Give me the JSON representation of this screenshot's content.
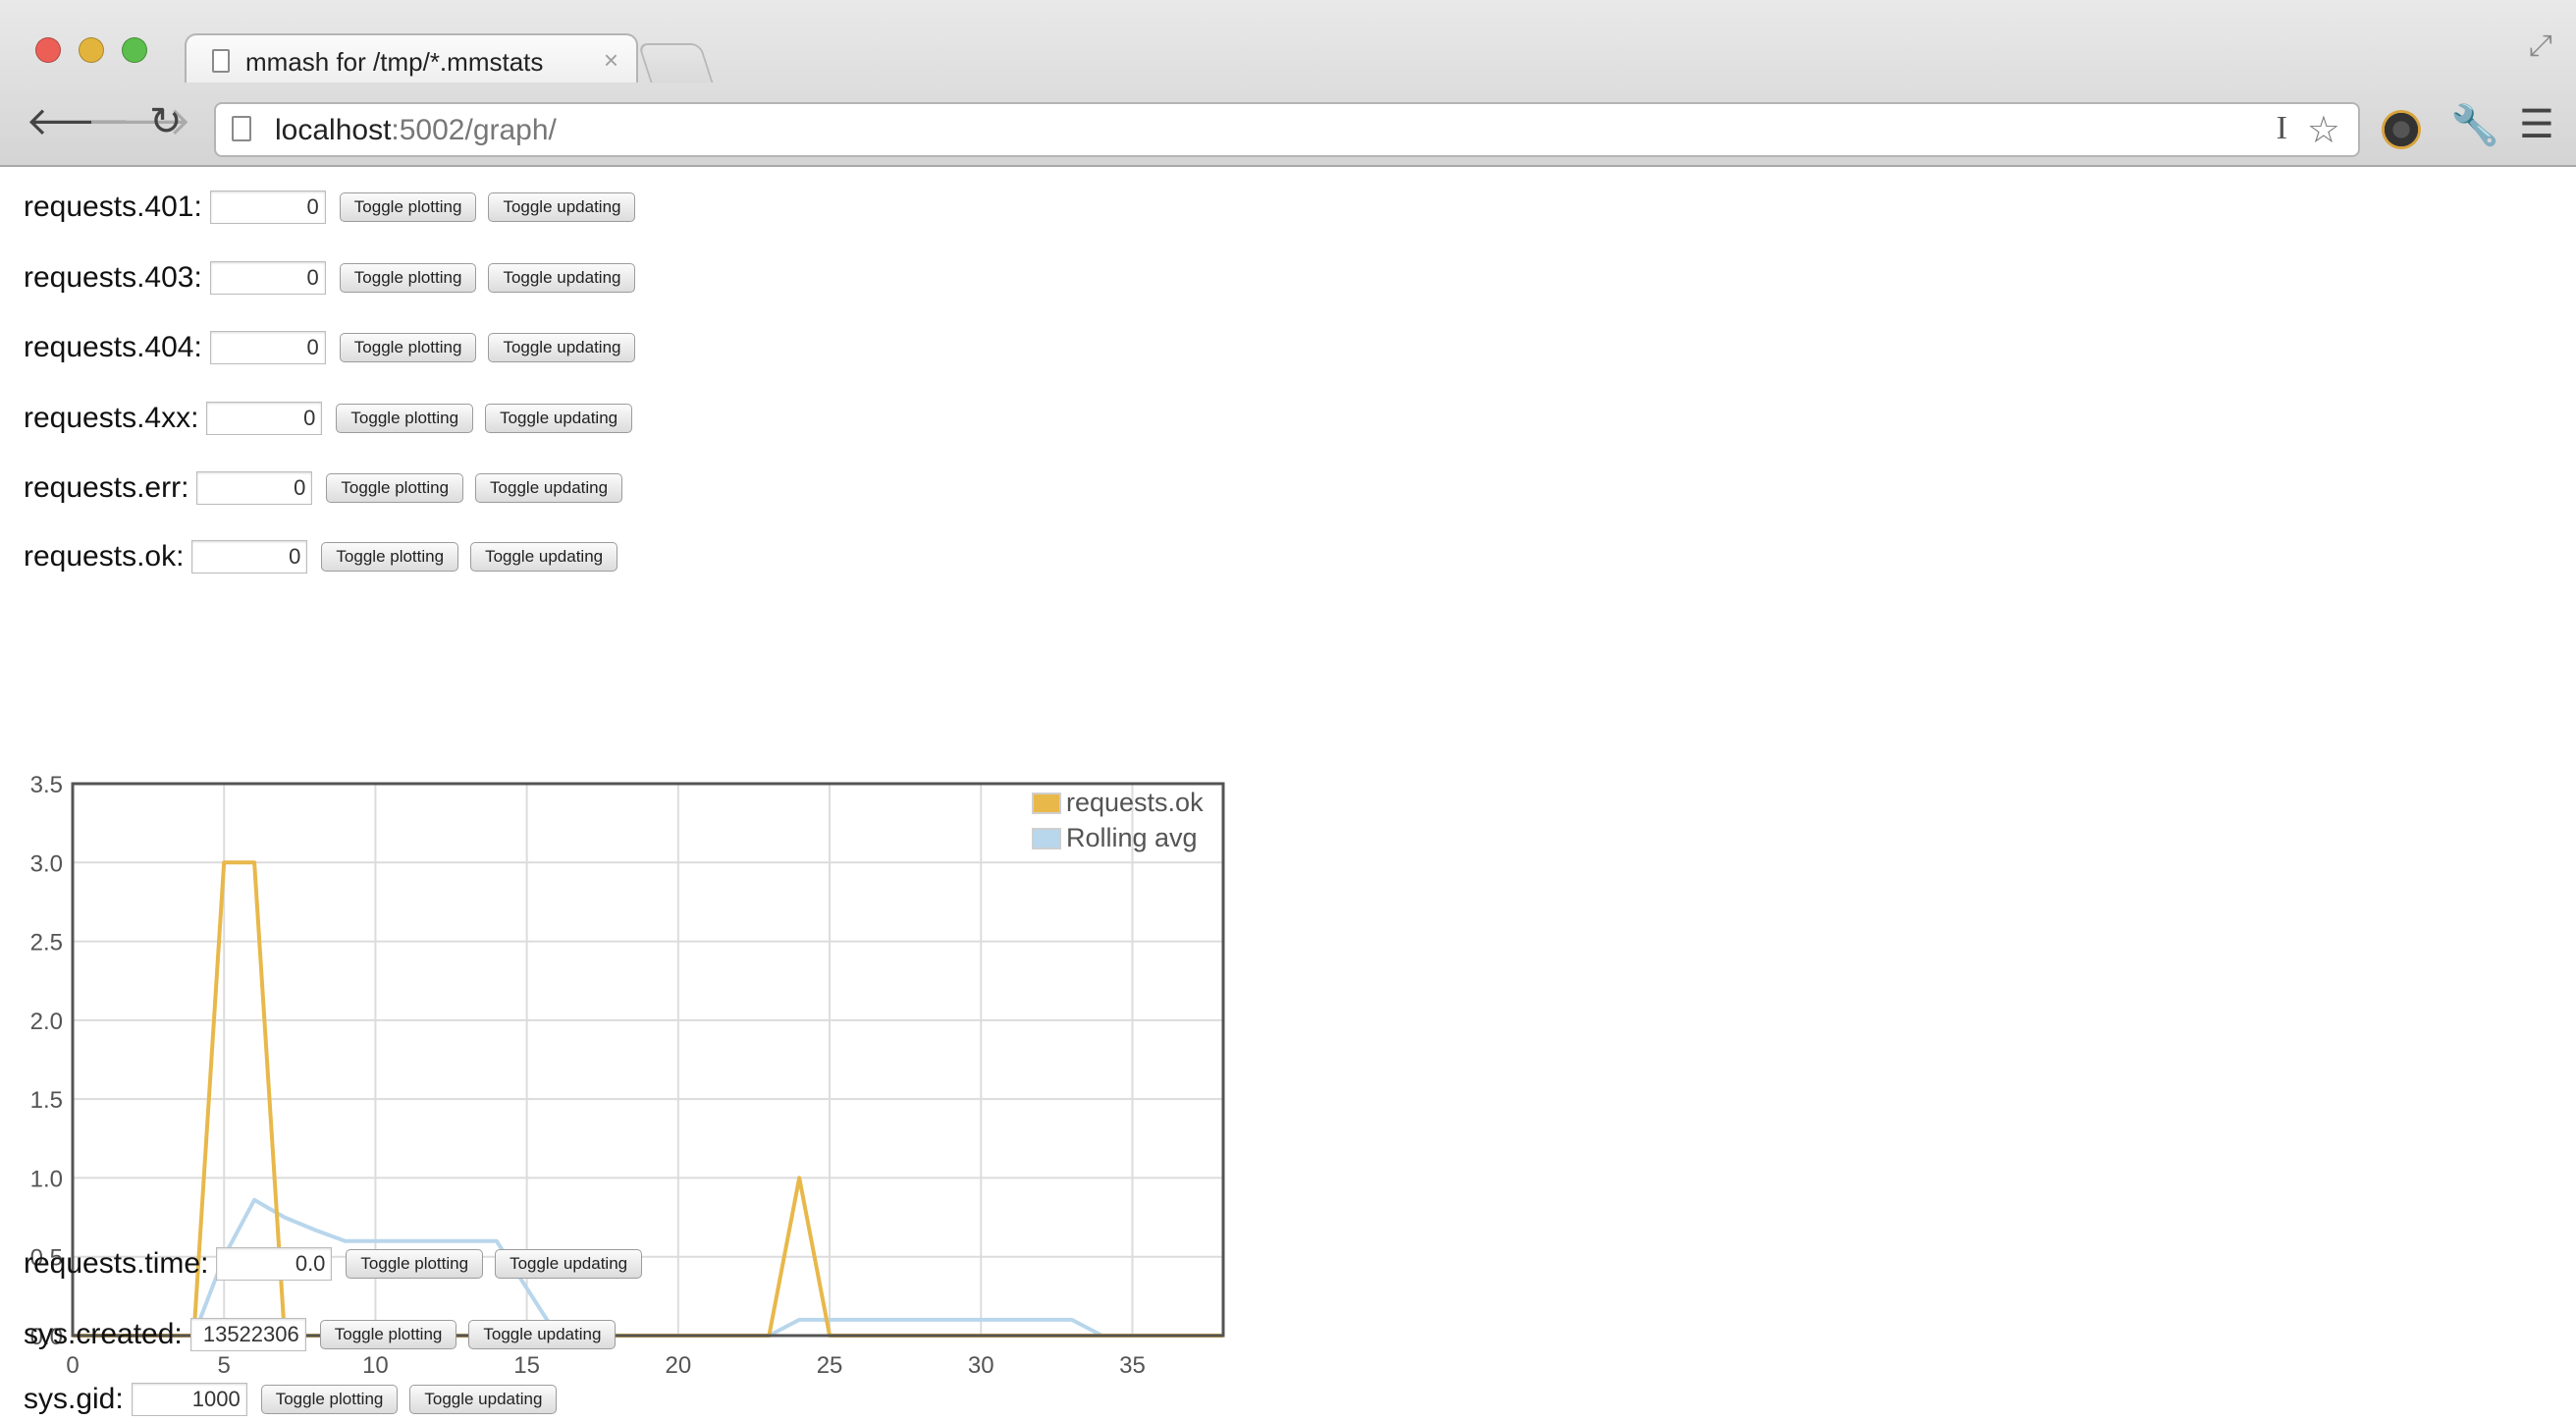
{
  "browser": {
    "tab": {
      "title": "mmash for /tmp/*.mmstats",
      "close_glyph": "×"
    },
    "address_bar": {
      "host": "localhost",
      "path": ":5002/graph/"
    }
  },
  "stats_before_chart": [
    {
      "label": "requests.401:",
      "value": "0"
    },
    {
      "label": "requests.403:",
      "value": "0"
    },
    {
      "label": "requests.404:",
      "value": "0"
    },
    {
      "label": "requests.4xx:",
      "value": "0"
    },
    {
      "label": "requests.err:",
      "value": "0"
    },
    {
      "label": "requests.ok:",
      "value": "0"
    }
  ],
  "stats_after_chart": [
    {
      "label": "requests.time:",
      "value": "0.0"
    },
    {
      "label": "sys.created:",
      "value": "13522306"
    },
    {
      "label": "sys.gid:",
      "value": "1000"
    }
  ],
  "buttons": {
    "toggle_plotting": "Toggle plotting",
    "toggle_updating": "Toggle updating"
  },
  "icons": [
    "document-icon",
    "back-icon",
    "forward-icon",
    "reload-icon",
    "star-icon",
    "wrench-icon",
    "menu-icon",
    "fullscreen-icon"
  ],
  "chart_data": {
    "type": "line",
    "title": "",
    "xlabel": "",
    "ylabel": "",
    "xlim": [
      0,
      38
    ],
    "ylim": [
      0,
      3.5
    ],
    "x_ticks": [
      "0",
      "5",
      "10",
      "15",
      "20",
      "25",
      "30",
      "35"
    ],
    "y_ticks": [
      "0.0",
      "0.5",
      "1.0",
      "1.5",
      "2.0",
      "2.5",
      "3.0",
      "3.5"
    ],
    "grid": true,
    "legend_position": "top-right",
    "series": [
      {
        "name": "requests.ok",
        "color": "#e8b84a",
        "points": [
          [
            0,
            0
          ],
          [
            1,
            0
          ],
          [
            2,
            0
          ],
          [
            3,
            0
          ],
          [
            4,
            0
          ],
          [
            5,
            3
          ],
          [
            6,
            3
          ],
          [
            7,
            0
          ],
          [
            8,
            0
          ],
          [
            9,
            0
          ],
          [
            10,
            0
          ],
          [
            11,
            0
          ],
          [
            12,
            0
          ],
          [
            13,
            0
          ],
          [
            14,
            0
          ],
          [
            15,
            0
          ],
          [
            16,
            0
          ],
          [
            17,
            0
          ],
          [
            18,
            0
          ],
          [
            19,
            0
          ],
          [
            20,
            0
          ],
          [
            21,
            0
          ],
          [
            22,
            0
          ],
          [
            23,
            0
          ],
          [
            24,
            1
          ],
          [
            25,
            0
          ],
          [
            26,
            0
          ],
          [
            27,
            0
          ],
          [
            28,
            0
          ],
          [
            29,
            0
          ],
          [
            30,
            0
          ],
          [
            31,
            0
          ],
          [
            32,
            0
          ],
          [
            33,
            0
          ],
          [
            34,
            0
          ],
          [
            35,
            0
          ],
          [
            36,
            0
          ],
          [
            37,
            0
          ],
          [
            38,
            0
          ]
        ]
      },
      {
        "name": "Rolling avg",
        "color": "#b8d6ec",
        "points": [
          [
            0,
            0
          ],
          [
            4,
            0
          ],
          [
            5,
            0.5
          ],
          [
            6,
            0.86
          ],
          [
            7,
            0.75
          ],
          [
            8,
            0.67
          ],
          [
            9,
            0.6
          ],
          [
            10,
            0.6
          ],
          [
            11,
            0.6
          ],
          [
            12,
            0.6
          ],
          [
            13,
            0.6
          ],
          [
            14,
            0.6
          ],
          [
            15,
            0.3
          ],
          [
            16,
            0
          ],
          [
            23,
            0
          ],
          [
            24,
            0.1
          ],
          [
            25,
            0.1
          ],
          [
            26,
            0.1
          ],
          [
            27,
            0.1
          ],
          [
            28,
            0.1
          ],
          [
            29,
            0.1
          ],
          [
            30,
            0.1
          ],
          [
            31,
            0.1
          ],
          [
            32,
            0.1
          ],
          [
            33,
            0.1
          ],
          [
            34,
            0
          ],
          [
            38,
            0
          ]
        ]
      }
    ]
  }
}
